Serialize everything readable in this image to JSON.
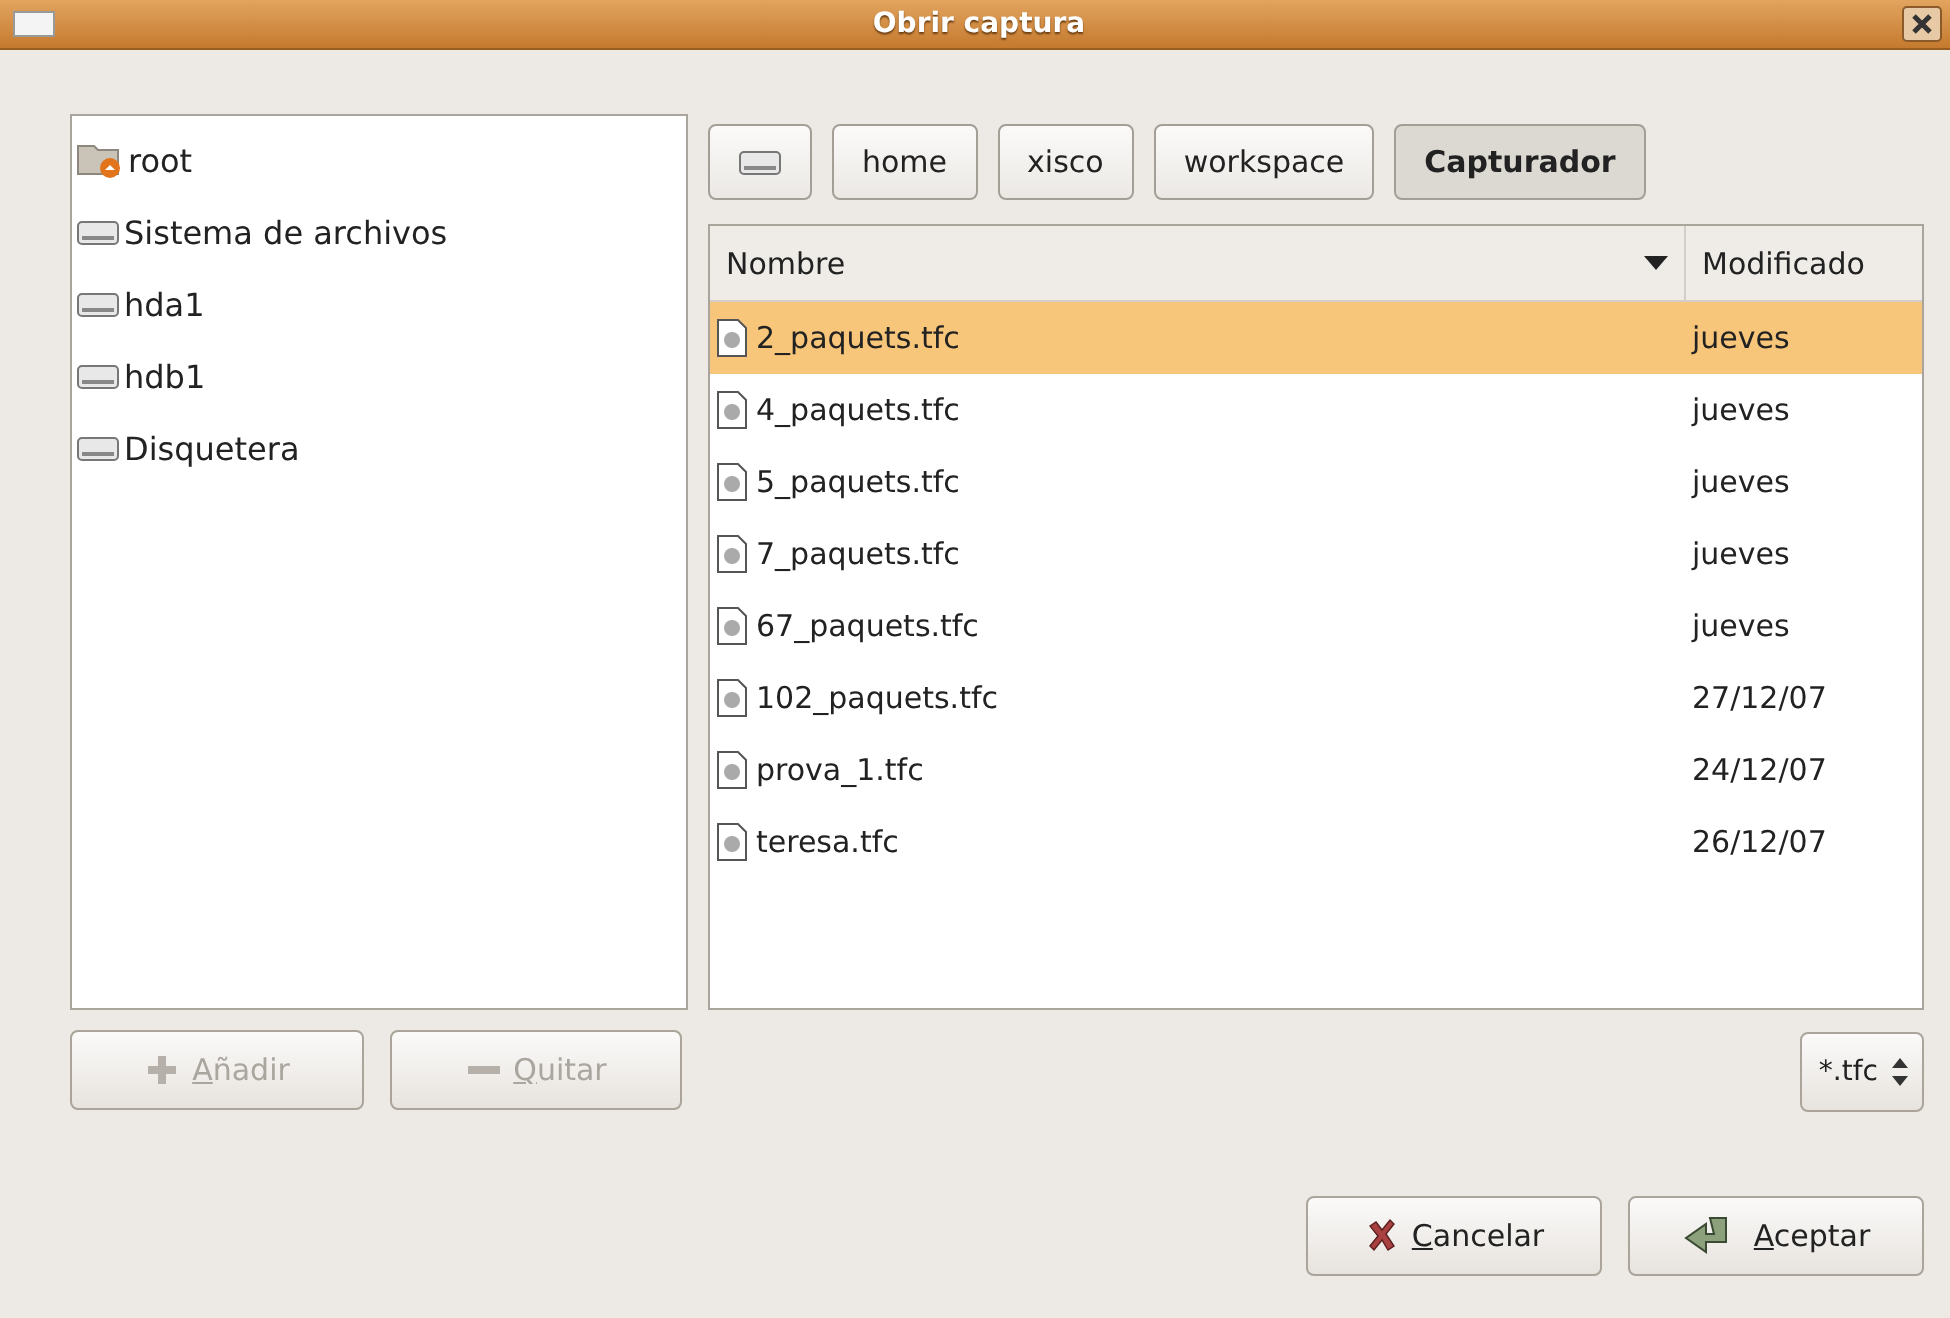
{
  "window": {
    "title": "Obrir captura"
  },
  "places": [
    {
      "name": "root",
      "kind": "home",
      "selected": false
    },
    {
      "name": "Sistema de archivos",
      "kind": "drive",
      "selected": false
    },
    {
      "name": "hda1",
      "kind": "drive",
      "selected": false
    },
    {
      "name": "hdb1",
      "kind": "drive",
      "selected": false
    },
    {
      "name": "Disquetera",
      "kind": "floppy",
      "selected": false
    }
  ],
  "place_buttons": [
    {
      "label": "Añadir",
      "kind": "add",
      "disabled": true
    },
    {
      "label": "Quitar",
      "kind": "remove",
      "disabled": true
    }
  ],
  "path_bar": [
    {
      "kind": "drive",
      "selected": false
    },
    {
      "label": "home",
      "selected": false
    },
    {
      "label": "xisco",
      "selected": false
    },
    {
      "label": "workspace",
      "selected": false
    },
    {
      "label": "Capturador",
      "selected": true
    }
  ],
  "table": {
    "columns": [
      "Nombre",
      "Modificado"
    ],
    "rows": [
      {
        "name": "2_paquets.tfc",
        "modified": "jueves",
        "selected": true
      },
      {
        "name": "4_paquets.tfc",
        "modified": "jueves",
        "selected": false
      },
      {
        "name": "5_paquets.tfc",
        "modified": "jueves",
        "selected": false
      },
      {
        "name": "7_paquets.tfc",
        "modified": "jueves",
        "selected": false
      },
      {
        "name": "67_paquets.tfc",
        "modified": "jueves",
        "selected": false
      },
      {
        "name": "102_paquets.tfc",
        "modified": "27/12/07",
        "selected": false
      },
      {
        "name": "prova_1.tfc",
        "modified": "24/12/07",
        "selected": false
      },
      {
        "name": "teresa.tfc",
        "modified": "26/12/07",
        "selected": false
      }
    ]
  },
  "filter": {
    "value": "*.tfc"
  },
  "buttons": [
    {
      "label": "Cancelar",
      "kind": "cancel"
    },
    {
      "label": "Aceptar",
      "kind": "ok"
    }
  ]
}
